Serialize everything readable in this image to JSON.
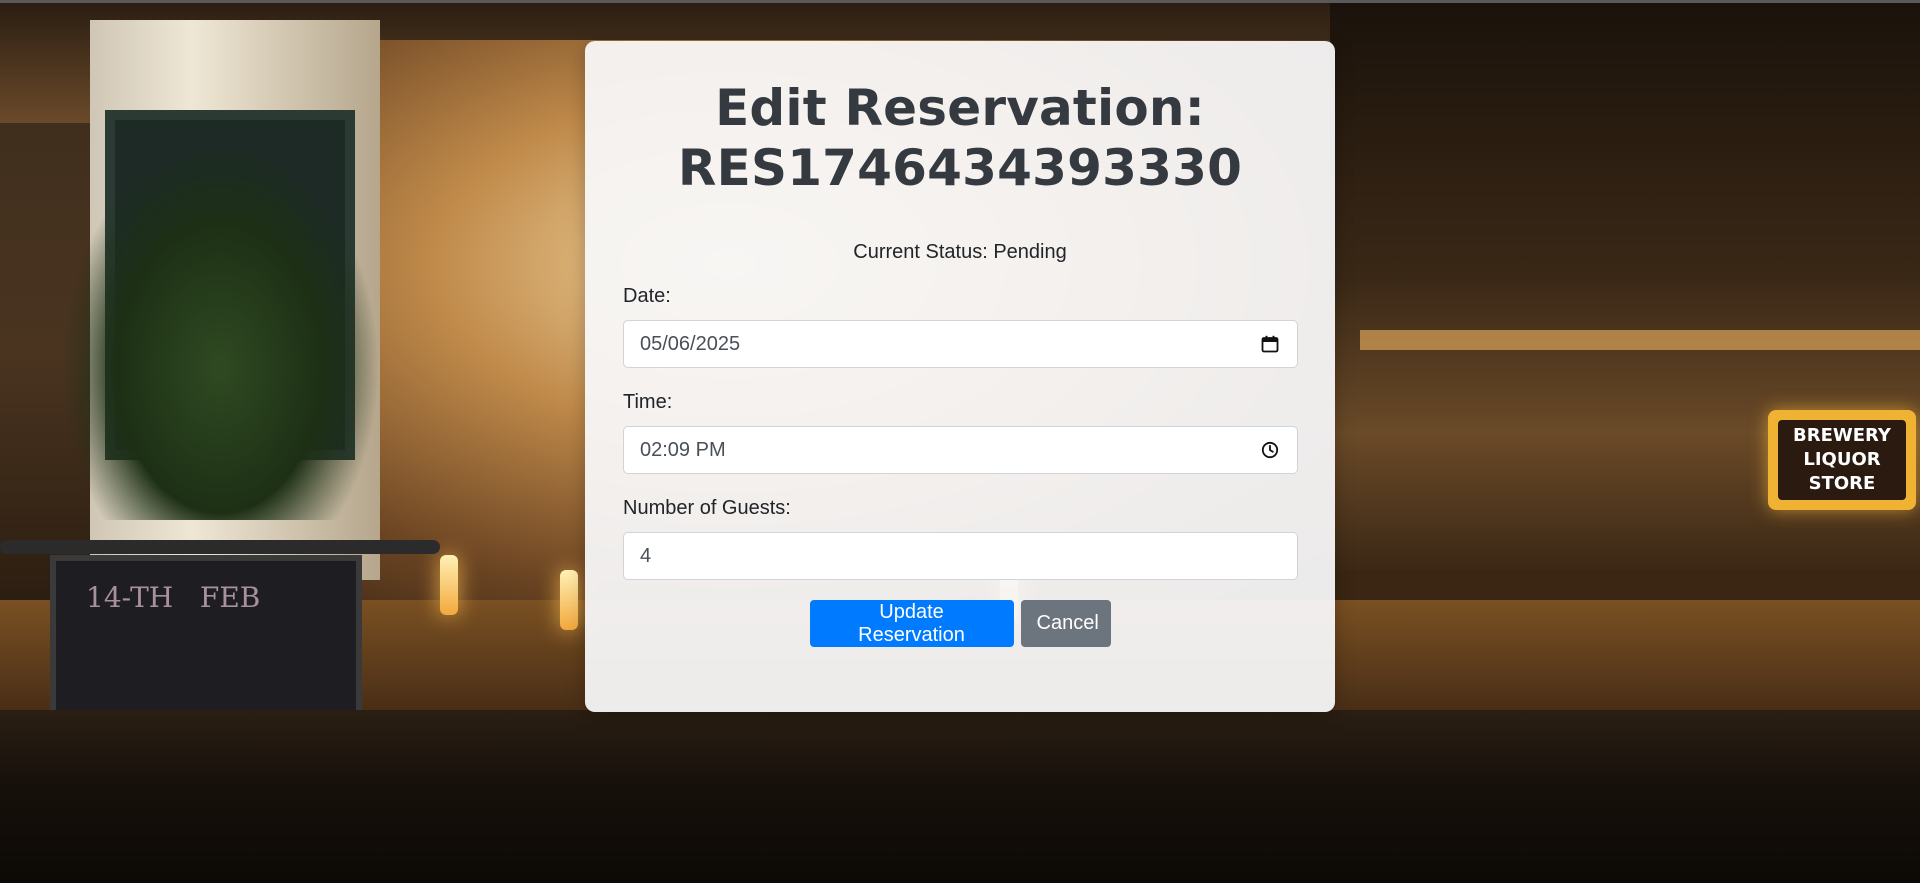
{
  "page": {
    "title_line1": "Edit Reservation:",
    "title_line2": "RES1746434393330"
  },
  "status": {
    "text": "Current Status: Pending"
  },
  "form": {
    "date": {
      "label": "Date:",
      "value": "05/06/2025",
      "icon": "calendar-icon"
    },
    "time": {
      "label": "Time:",
      "value": "02:09 PM",
      "icon": "clock-icon"
    },
    "guests": {
      "label": "Number of Guests:",
      "value": "4"
    }
  },
  "buttons": {
    "update_label": "Update Reservation",
    "cancel_label": "Cancel"
  },
  "background": {
    "sign_lines": [
      "BREWERY",
      "LIQUOR",
      "STORE"
    ],
    "chalk_text": [
      "14-TH",
      "FEB"
    ]
  },
  "colors": {
    "primary": "#007bff",
    "secondary": "#6c757d",
    "title": "#343a40",
    "card": "#f8f8f9"
  }
}
